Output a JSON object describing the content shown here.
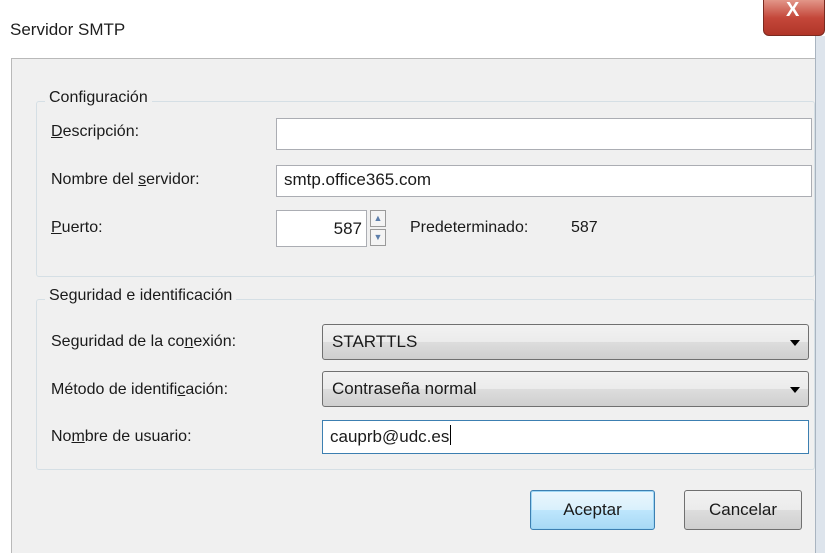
{
  "window": {
    "title": "Servidor SMTP",
    "close_glyph": "X"
  },
  "config_group": {
    "legend": "Configuración",
    "description": {
      "label_u": "D",
      "label_rest": "escripción:",
      "value": ""
    },
    "server": {
      "label_a": "Nombre del ",
      "label_u": "s",
      "label_b": "ervidor:",
      "value": "smtp.office365.com"
    },
    "port": {
      "label_u": "P",
      "label_rest": "uerto:",
      "value": "587",
      "default_label": "Predeterminado:",
      "default_value": "587"
    }
  },
  "security_group": {
    "legend": "Seguridad e identificación",
    "connection": {
      "label_a": "Seguridad de la co",
      "label_u": "n",
      "label_b": "exión:",
      "selected": "STARTTLS"
    },
    "auth": {
      "label_a": "Método de identifi",
      "label_u": "c",
      "label_b": "ación:",
      "selected": "Contraseña normal"
    },
    "username": {
      "label_a": "No",
      "label_u": "m",
      "label_b": "bre de usuario:",
      "value": "cauprb@udc.es"
    }
  },
  "buttons": {
    "ok": "Aceptar",
    "cancel": "Cancelar"
  },
  "icons": {
    "spin_up": "▲",
    "spin_down": "▼"
  }
}
